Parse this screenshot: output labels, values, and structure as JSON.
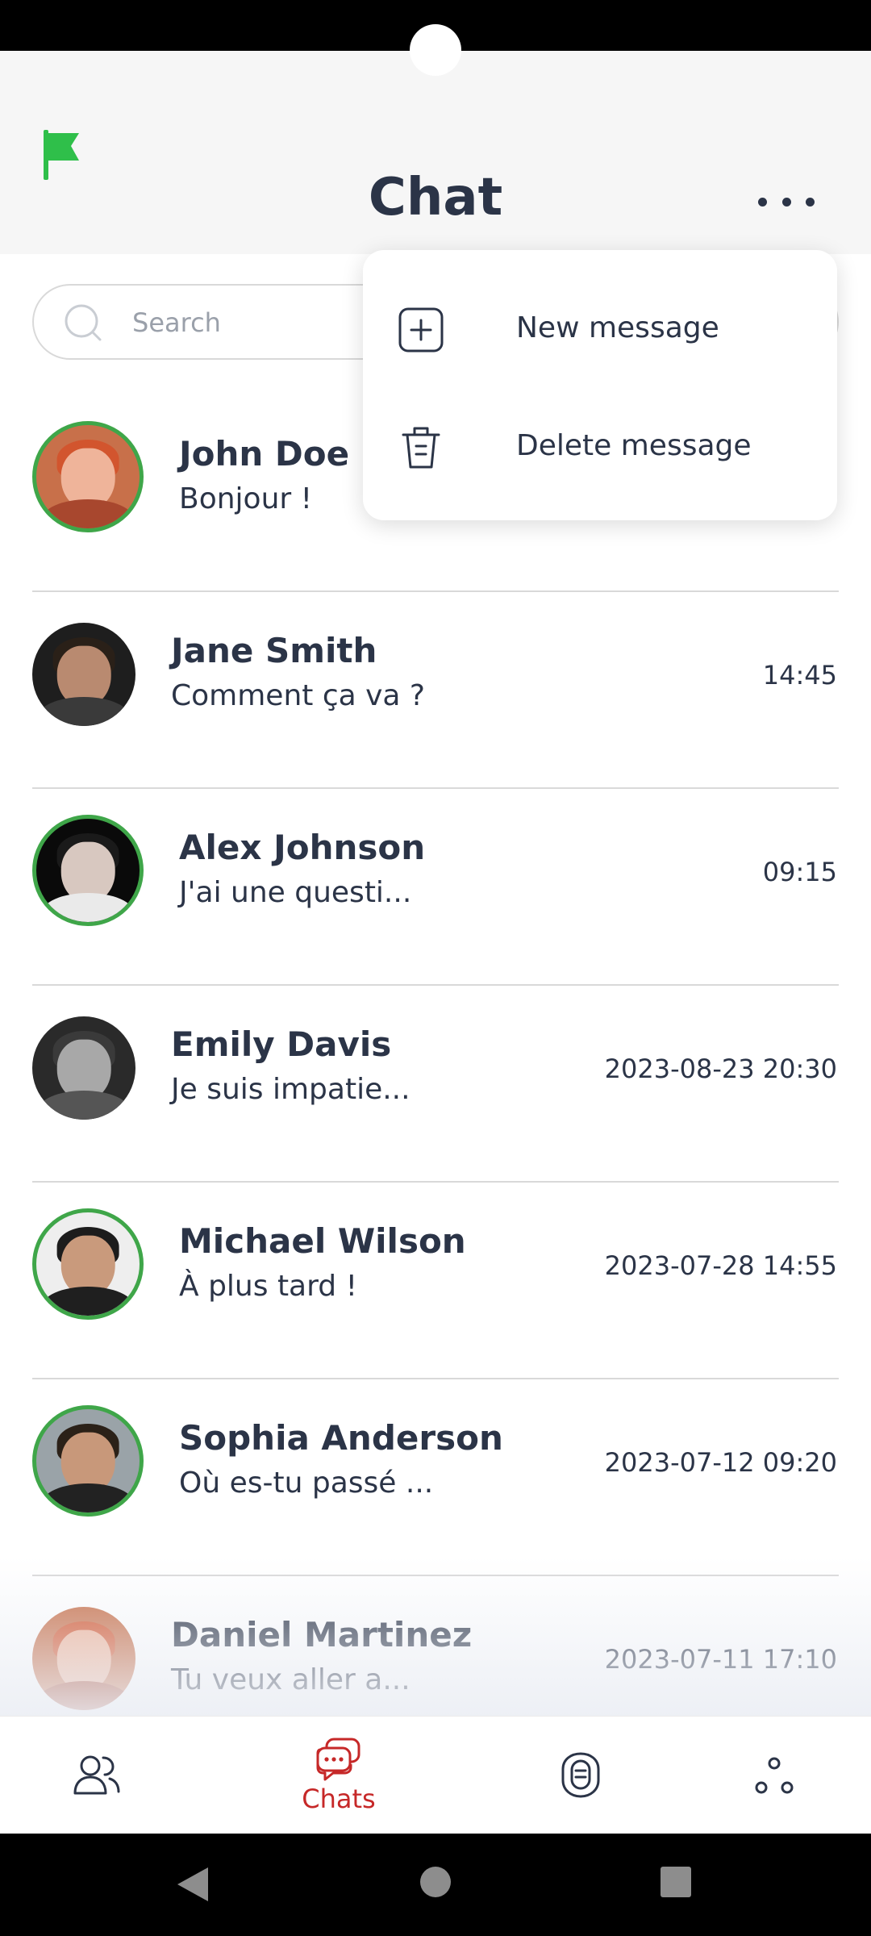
{
  "header": {
    "title": "Chat",
    "flag_icon": "flag-icon",
    "more_icon": "more-horizontal-icon"
  },
  "search": {
    "placeholder": "Search",
    "icon": "search-icon"
  },
  "menu": {
    "items": [
      {
        "label": "New message",
        "icon": "plus-square-icon"
      },
      {
        "label": "Delete message",
        "icon": "trash-icon"
      }
    ]
  },
  "chats": [
    {
      "name": "John Doe",
      "preview": "Bonjour !",
      "time": "",
      "online": true
    },
    {
      "name": "Jane Smith",
      "preview": "Comment ça va ?",
      "time": "14:45",
      "online": false
    },
    {
      "name": "Alex Johnson",
      "preview": "J'ai une questi...",
      "time": "09:15",
      "online": true
    },
    {
      "name": "Emily Davis",
      "preview": "Je suis impatie...",
      "time": "2023-08-23 20:30",
      "online": false
    },
    {
      "name": "Michael Wilson",
      "preview": "À plus tard !",
      "time": "2023-07-28 14:55",
      "online": true
    },
    {
      "name": "Sophia Anderson",
      "preview": "Où es-tu passé ...",
      "time": "2023-07-12 09:20",
      "online": true
    },
    {
      "name": "Daniel Martinez",
      "preview": "Tu veux aller a...",
      "time": "2023-07-11 17:10",
      "online": false
    }
  ],
  "bottom_nav": {
    "items": [
      {
        "label": "",
        "icon": "contacts-icon",
        "active": false
      },
      {
        "label": "Chats",
        "icon": "chat-bubbles-icon",
        "active": true
      },
      {
        "label": "",
        "icon": "microphone-icon",
        "active": false
      },
      {
        "label": "",
        "icon": "share-nodes-icon",
        "active": false
      }
    ]
  },
  "colors": {
    "accent": "#c62828",
    "online_ring": "#3fa649",
    "flag": "#2fbf4a",
    "text": "#2b3447"
  }
}
